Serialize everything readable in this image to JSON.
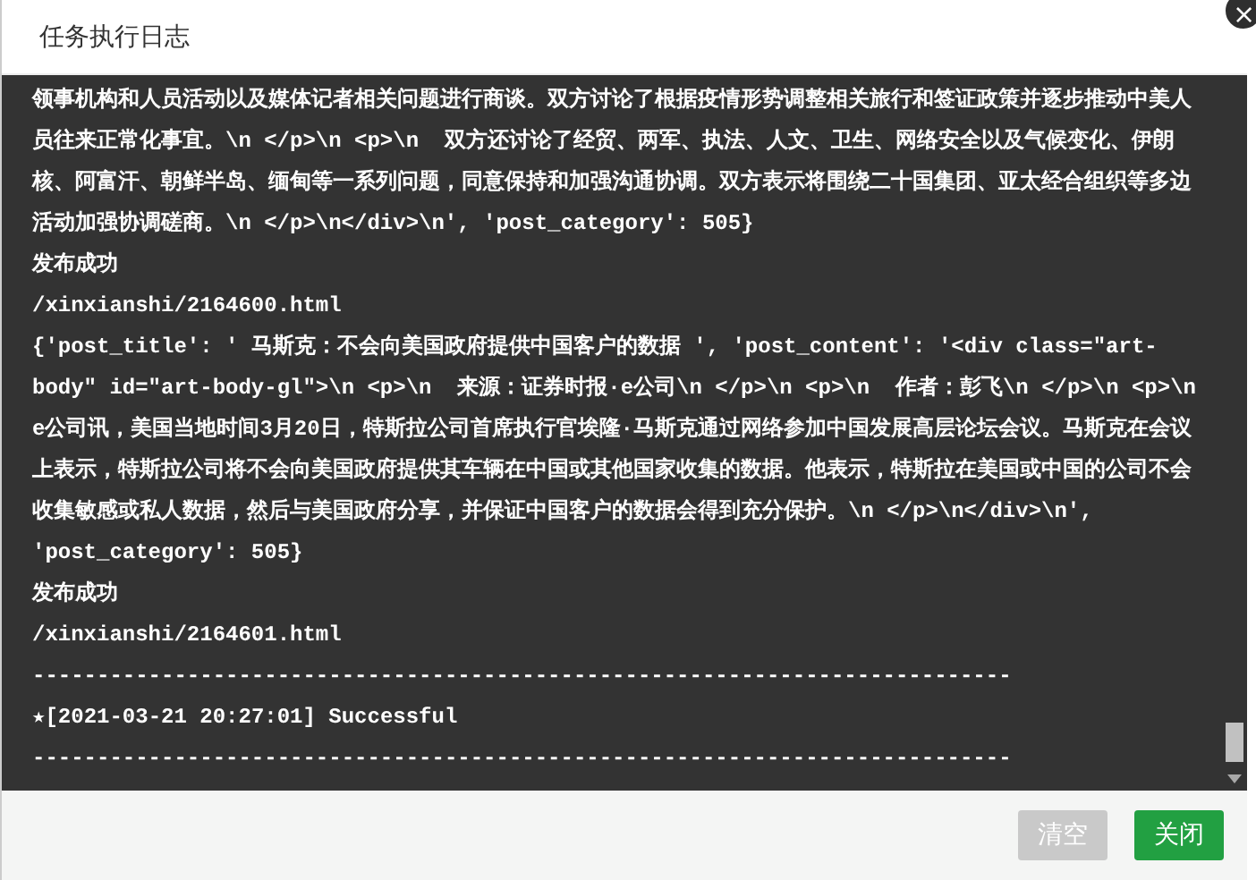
{
  "dialog": {
    "title": "任务执行日志",
    "close_symbol": "×"
  },
  "log": [
    "领事机构和人员活动以及媒体记者相关问题进行商谈。双方讨论了根据疫情形势调整相关旅行和签证政策并逐步推动中美人员往来正常化事宜。\\n </p>\\n <p>\\n  双方还讨论了经贸、两军、执法、人文、卫生、网络安全以及气候变化、伊朗核、阿富汗、朝鲜半岛、缅甸等一系列问题，同意保持和加强沟通协调。双方表示将围绕二十国集团、亚太经合组织等多边活动加强协调磋商。\\n </p>\\n</div>\\n', 'post_category': 505}",
    "发布成功",
    "/xinxianshi/2164600.html",
    "{'post_title': ' 马斯克：不会向美国政府提供中国客户的数据 ', 'post_content': '<div class=\"art-body\" id=\"art-body-gl\">\\n <p>\\n  来源：证券时报·e公司\\n </p>\\n <p>\\n  作者：彭飞\\n </p>\\n <p>\\n  e公司讯，美国当地时间3月20日，特斯拉公司首席执行官埃隆·马斯克通过网络参加中国发展高层论坛会议。马斯克在会议上表示，特斯拉公司将不会向美国政府提供其车辆在中国或其他国家收集的数据。他表示，特斯拉在美国或中国的公司不会收集敏感或私人数据，然后与美国政府分享，并保证中国客户的数据会得到充分保护。\\n </p>\\n</div>\\n', 'post_category': 505}",
    "发布成功",
    "/xinxianshi/2164601.html",
    "----------------------------------------------------------------------------",
    "★[2021-03-21 20:27:01] Successful",
    "----------------------------------------------------------------------------"
  ],
  "buttons": [
    {
      "label": "清空",
      "disabled": true
    },
    {
      "label": "关闭",
      "disabled": false
    }
  ]
}
